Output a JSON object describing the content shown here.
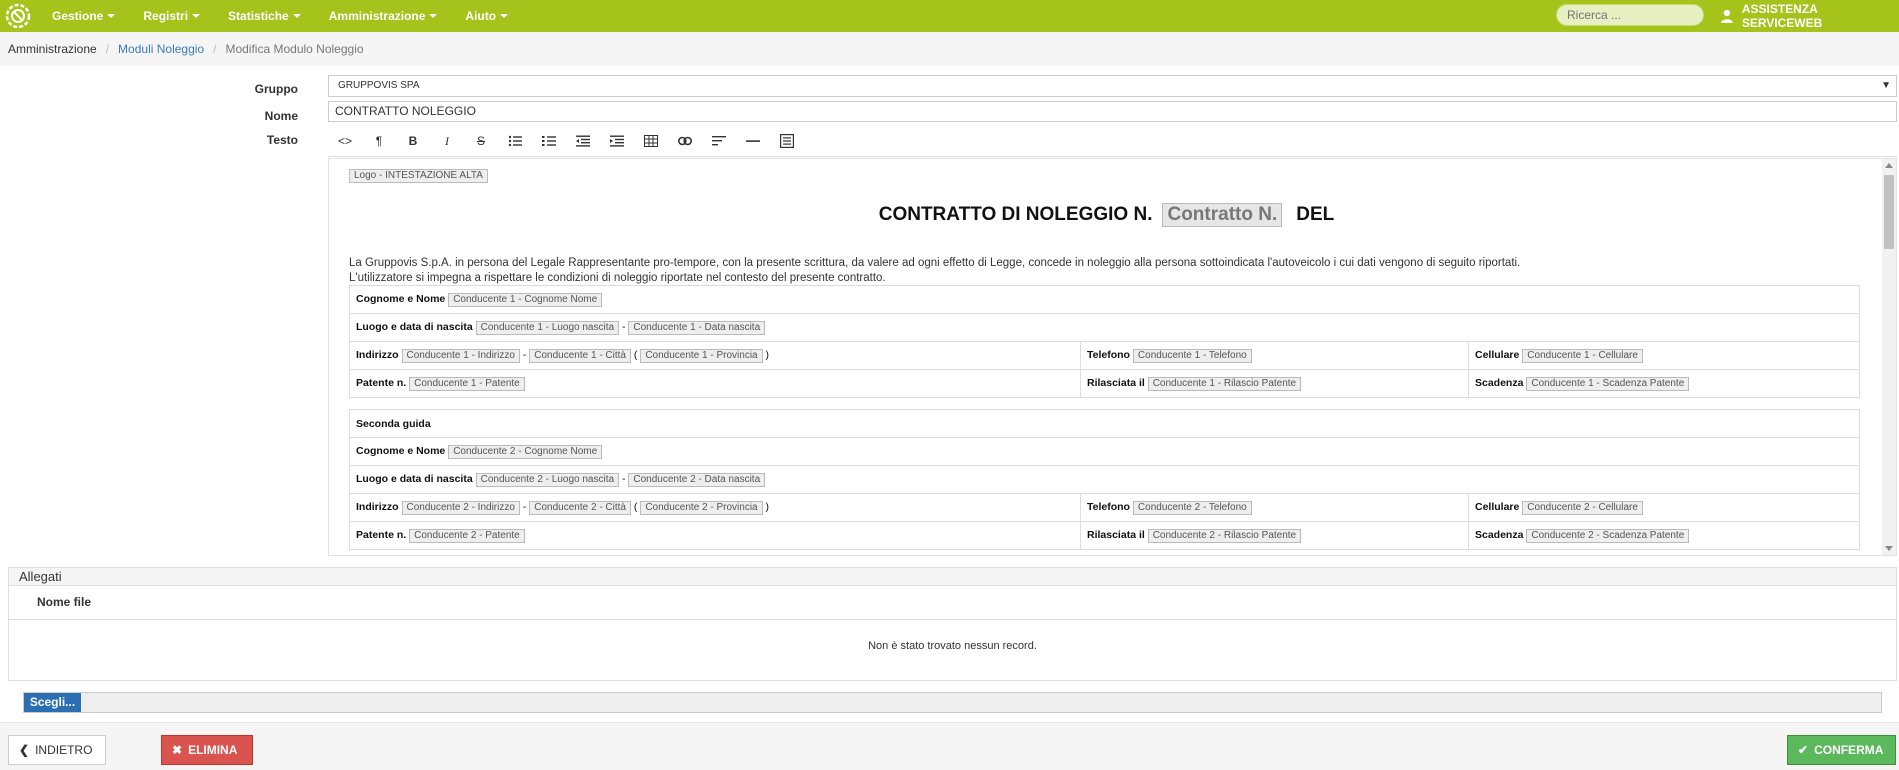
{
  "navbar": {
    "menu": [
      {
        "label": "Gestione"
      },
      {
        "label": "Registri"
      },
      {
        "label": "Statistiche"
      },
      {
        "label": "Amministrazione"
      },
      {
        "label": "Aiuto"
      }
    ],
    "search_placeholder": "Ricerca ...",
    "user_label": "ASSISTENZA SERVICEWEB"
  },
  "breadcrumb": {
    "root": "Amministrazione",
    "parent": "Moduli Noleggio",
    "current": "Modifica Modulo Noleggio"
  },
  "form": {
    "gruppo_label": "Gruppo",
    "gruppo_value": "GRUPPOVIS SPA",
    "nome_label": "Nome",
    "nome_value": "CONTRATTO NOLEGGIO",
    "testo_label": "Testo"
  },
  "toolbar_icons": [
    "code-icon",
    "paragraph-icon",
    "bold-icon",
    "italic-icon",
    "strikethrough-icon",
    "unordered-list-icon",
    "ordered-list-icon",
    "outdent-icon",
    "indent-icon",
    "table-icon",
    "link-icon",
    "align-icon",
    "horizontal-rule-icon",
    "fullscreen-icon"
  ],
  "editor": {
    "logo_placeholder": "Logo - INTESTAZIONE ALTA",
    "title_prefix": "CONTRATTO DI NOLEGGIO N.",
    "title_placeholder": "Contratto N.",
    "title_suffix": "DEL",
    "intro_line1": "La Gruppovis S.p.A. in persona del Legale Rappresentante pro-tempore, con la presente scrittura, da valere ad ogni effetto di Legge, concede in noleggio alla persona sottoindicata l'autoveicolo i cui dati vengono di seguito riportati.",
    "intro_line2": "L'utilizzatore si impegna a rispettare le condizioni di noleggio riportate nel contesto del presente contratto.",
    "driver1": {
      "cognome_label": "Cognome e Nome",
      "cognome_ph": "Conducente 1 - Cognome Nome",
      "nascita_label": "Luogo e data di nascita",
      "luogo_ph": "Conducente 1 - Luogo nascita",
      "data_ph": "Conducente 1 - Data nascita",
      "indirizzo_label": "Indirizzo",
      "indirizzo_ph": "Conducente 1 - Indirizzo",
      "citta_ph": "Conducente 1 - Città",
      "provincia_ph": "Conducente 1 - Provincia",
      "telefono_label": "Telefono",
      "telefono_ph": "Conducente 1 - Telefono",
      "cellulare_label": "Cellulare",
      "cellulare_ph": "Conducente 1 - Cellulare",
      "patente_label": "Patente n.",
      "patente_ph": "Conducente 1 - Patente",
      "rilascio_label": "Rilasciata il",
      "rilascio_ph": "Conducente 1 - Rilascio Patente",
      "scadenza_label": "Scadenza",
      "scadenza_ph": "Conducente 1 - Scadenza Patente"
    },
    "driver2": {
      "section_label": "Seconda guida",
      "cognome_label": "Cognome e Nome",
      "cognome_ph": "Conducente 2 - Cognome Nome",
      "nascita_label": "Luogo e data di nascita",
      "luogo_ph": "Conducente 2 - Luogo nascita",
      "data_ph": "Conducente 2 - Data nascita",
      "indirizzo_label": "Indirizzo",
      "indirizzo_ph": "Conducente 2 - Indirizzo",
      "citta_ph": "Conducente 2 - Città",
      "provincia_ph": "Conducente 2 - Provincia",
      "telefono_label": "Telefono",
      "telefono_ph": "Conducente 2 - Telefono",
      "cellulare_label": "Cellulare",
      "cellulare_ph": "Conducente 2 - Cellulare",
      "patente_label": "Patente n.",
      "patente_ph": "Conducente 2 - Patente",
      "rilascio_label": "Rilasciata il",
      "rilascio_ph": "Conducente 2 - Rilascio Patente",
      "scadenza_label": "Scadenza",
      "scadenza_ph": "Conducente 2 - Scadenza Patente"
    }
  },
  "allegati": {
    "title": "Allegati",
    "column": "Nome file",
    "empty": "Non è stato trovato nessun record.",
    "choose_label": "Scegli..."
  },
  "footer": {
    "back_label": "INDIETRO",
    "delete_label": "ELIMINA",
    "confirm_label": "CONFERMA"
  },
  "colors": {
    "navbar": "#a5c31a",
    "delete": "#d9534f",
    "confirm": "#5cb85c",
    "choose": "#2b6fb3",
    "link": "#3a7bbf"
  }
}
